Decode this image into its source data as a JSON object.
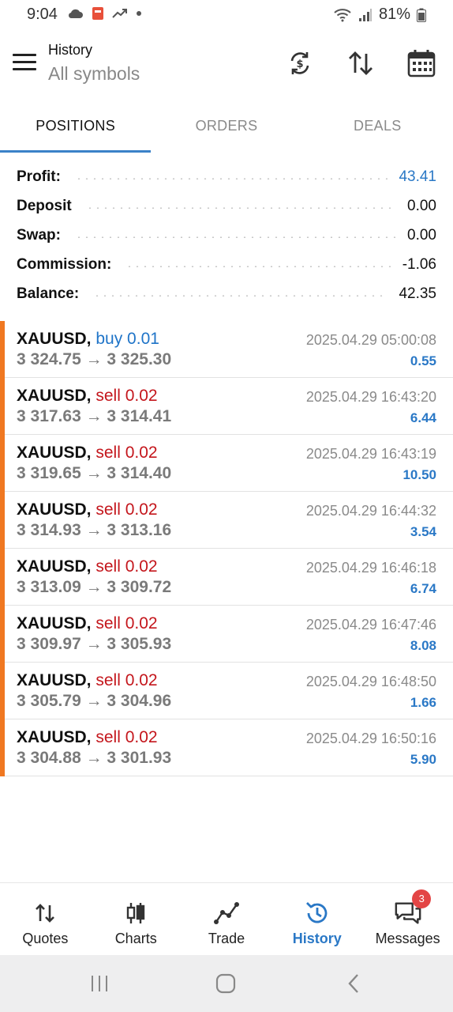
{
  "status_bar": {
    "time": "9:04",
    "battery": "81%",
    "icons": [
      "cloud-icon",
      "pay-notification-icon",
      "trend-icon",
      "dot-icon",
      "wifi-icon",
      "signal-icon",
      "battery-icon"
    ]
  },
  "header": {
    "title": "History",
    "subtitle": "All symbols",
    "buttons": [
      "sync-currency-icon",
      "sort-icon",
      "calendar-icon"
    ]
  },
  "tabs": [
    {
      "label": "POSITIONS",
      "active": true
    },
    {
      "label": "ORDERS",
      "active": false
    },
    {
      "label": "DEALS",
      "active": false
    }
  ],
  "summary": [
    {
      "label": "Profit:",
      "value": "43.41",
      "highlight": true
    },
    {
      "label": "Deposit",
      "value": "0.00",
      "highlight": false
    },
    {
      "label": "Swap:",
      "value": "0.00",
      "highlight": false
    },
    {
      "label": "Commission:",
      "value": "-1.06",
      "highlight": false
    },
    {
      "label": "Balance:",
      "value": "42.35",
      "highlight": false
    }
  ],
  "positions": [
    {
      "symbol": "XAUUSD,",
      "direction": "buy 0.01",
      "type": "buy",
      "prices": "3 324.75 → 3 325.30",
      "time": "2025.04.29 05:00:08",
      "profit": "0.55"
    },
    {
      "symbol": "XAUUSD,",
      "direction": "sell 0.02",
      "type": "sell",
      "prices": "3 317.63 → 3 314.41",
      "time": "2025.04.29 16:43:20",
      "profit": "6.44"
    },
    {
      "symbol": "XAUUSD,",
      "direction": "sell 0.02",
      "type": "sell",
      "prices": "3 319.65 → 3 314.40",
      "time": "2025.04.29 16:43:19",
      "profit": "10.50"
    },
    {
      "symbol": "XAUUSD,",
      "direction": "sell 0.02",
      "type": "sell",
      "prices": "3 314.93 → 3 313.16",
      "time": "2025.04.29 16:44:32",
      "profit": "3.54"
    },
    {
      "symbol": "XAUUSD,",
      "direction": "sell 0.02",
      "type": "sell",
      "prices": "3 313.09 → 3 309.72",
      "time": "2025.04.29 16:46:18",
      "profit": "6.74"
    },
    {
      "symbol": "XAUUSD,",
      "direction": "sell 0.02",
      "type": "sell",
      "prices": "3 309.97 → 3 305.93",
      "time": "2025.04.29 16:47:46",
      "profit": "8.08"
    },
    {
      "symbol": "XAUUSD,",
      "direction": "sell 0.02",
      "type": "sell",
      "prices": "3 305.79 → 3 304.96",
      "time": "2025.04.29 16:48:50",
      "profit": "1.66"
    },
    {
      "symbol": "XAUUSD,",
      "direction": "sell 0.02",
      "type": "sell",
      "prices": "3 304.88 → 3 301.93",
      "time": "2025.04.29 16:50:16",
      "profit": "5.90"
    }
  ],
  "bottom_nav": [
    {
      "label": "Quotes",
      "icon": "quotes-arrows-icon",
      "active": false
    },
    {
      "label": "Charts",
      "icon": "candlestick-icon",
      "active": false
    },
    {
      "label": "Trade",
      "icon": "trade-line-icon",
      "active": false
    },
    {
      "label": "History",
      "icon": "history-clock-icon",
      "active": true
    },
    {
      "label": "Messages",
      "icon": "messages-icon",
      "active": false,
      "badge": "3"
    }
  ],
  "colors": {
    "accent_blue": "#2a78c6",
    "buy_blue": "#1f74c8",
    "sell_red": "#c4161c",
    "row_marker_orange": "#f07821",
    "badge_red": "#e34545"
  }
}
